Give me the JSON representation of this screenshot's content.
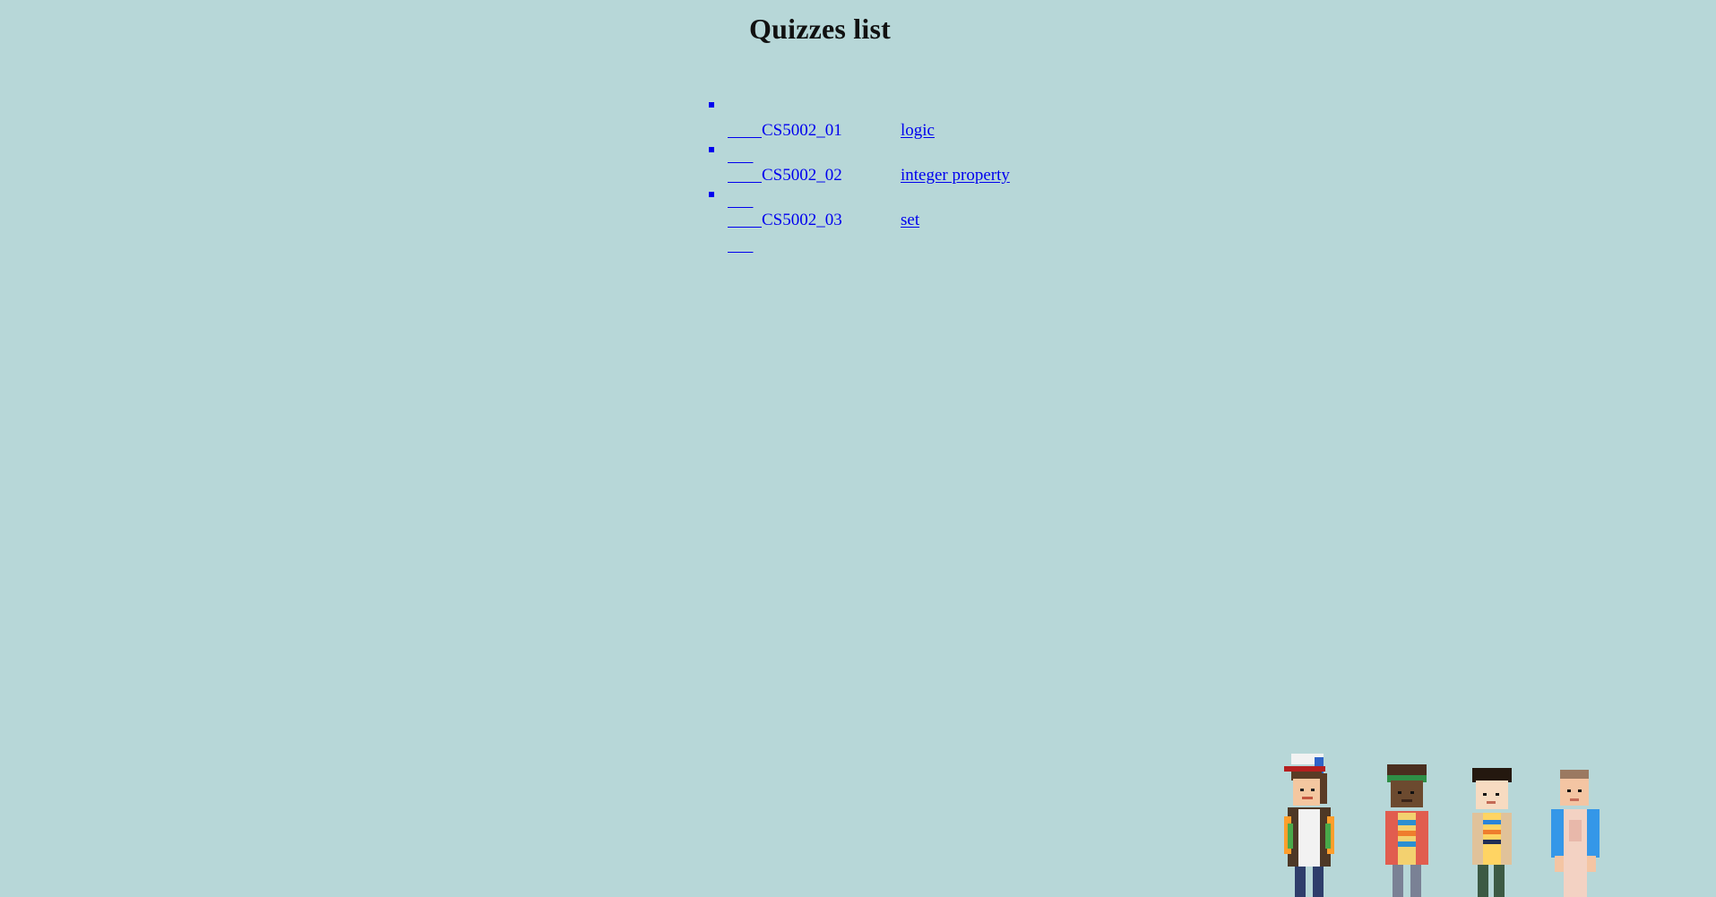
{
  "page": {
    "title": "Quizzes list"
  },
  "quizzes": [
    {
      "code": "CS5002_01",
      "topic": "logic"
    },
    {
      "code": "CS5002_02",
      "topic": "integer property"
    },
    {
      "code": "CS5002_03",
      "topic": "set"
    }
  ],
  "decoration": {
    "characters": [
      "character-cap",
      "character-headband",
      "character-boy",
      "character-girl"
    ]
  }
}
